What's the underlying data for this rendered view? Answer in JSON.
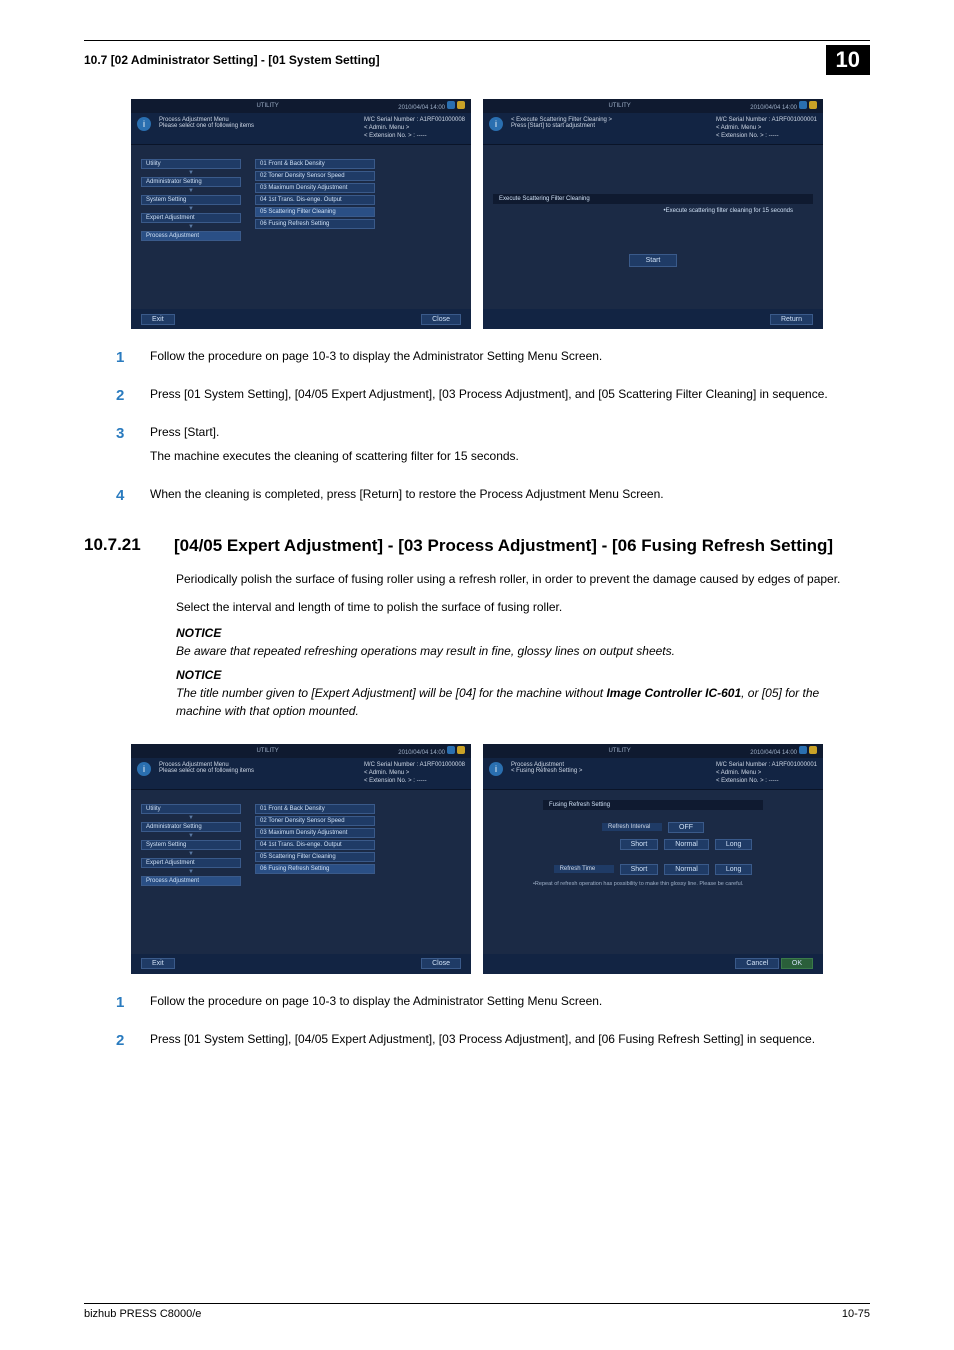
{
  "header": {
    "breadcrumb": "10.7   [02 Administrator Setting] - [01 System Setting]",
    "chapter": "10"
  },
  "screenshots1": {
    "left": {
      "topbar_title": "UTILITY",
      "topbar_date": "2010/04/04 14:00",
      "h_line1": "Process Adjustment Menu",
      "h_line2": "Please select one of following items",
      "r_line1": "M/C Serial Number : A1RF001000008",
      "r_line2": "< Admin. Menu >",
      "r_line3": "< Extension No. > : -----",
      "bread": [
        "Utility",
        "Administrator Setting",
        "System Setting",
        "Expert Adjustment",
        "Process Adjustment"
      ],
      "menu": [
        "01 Front & Back Density",
        "02 Toner Density Sensor Speed",
        "03 Maximum Density Adjustment",
        "04 1st Trans. Dis-enge. Output",
        "05 Scattering Filter Cleaning",
        "06 Fusing Refresh Setting"
      ],
      "menu_hl_index": 4,
      "btn_exit": "Exit",
      "btn_close": "Close"
    },
    "right": {
      "topbar_title": "UTILITY",
      "topbar_date": "2010/04/04 14:00",
      "h_line1": "< Execute Scattering Filter Cleaning >",
      "h_line2": "Press [Start] to start adjustment",
      "r_line1": "M/C Serial Number : A1RF001000001",
      "r_line2": "< Admin. Menu >",
      "r_line3": "< Extension No. > : -----",
      "panel_title": "Execute Scattering Filter Cleaning",
      "note": "•Execute scattering filter cleaning for 15 seconds",
      "btn_start": "Start",
      "btn_return": "Return"
    }
  },
  "steps1": [
    {
      "num": "1",
      "lines": [
        "Follow the procedure on page 10-3 to display the Administrator Setting Menu Screen."
      ]
    },
    {
      "num": "2",
      "lines": [
        "Press [01 System Setting], [04/05 Expert Adjustment], [03 Process Adjustment], and [05 Scattering Filter Cleaning] in sequence."
      ]
    },
    {
      "num": "3",
      "lines": [
        "Press [Start].",
        "The machine executes the cleaning of scattering filter for 15 seconds."
      ]
    },
    {
      "num": "4",
      "lines": [
        "When the cleaning is completed, press [Return] to restore the Process Adjustment Menu Screen."
      ]
    }
  ],
  "section": {
    "num": "10.7.21",
    "title": "[04/05 Expert Adjustment] - [03 Process Adjustment] - [06 Fusing Refresh Setting]"
  },
  "para1": "Periodically polish the surface of fusing roller using a refresh roller, in order to prevent the damage caused by edges of paper.",
  "para2": "Select the interval and length of time to polish the surface of fusing roller.",
  "notice_label": "NOTICE",
  "notice1": "Be aware that repeated refreshing operations may result in fine, glossy lines on output sheets.",
  "notice2_pre": "The title number given to [Expert Adjustment] will be [04] for the machine without ",
  "notice2_bold": "Image Controller IC-601",
  "notice2_post": ", or [05] for the machine with that option mounted.",
  "screenshots2": {
    "left": {
      "topbar_title": "UTILITY",
      "topbar_date": "2010/04/04 14:00",
      "h_line1": "Process Adjustment Menu",
      "h_line2": "Please select one of following items",
      "r_line1": "M/C Serial Number : A1RF001000008",
      "r_line2": "< Admin. Menu >",
      "r_line3": "< Extension No. > : -----",
      "bread": [
        "Utility",
        "Administrator Setting",
        "System Setting",
        "Expert Adjustment",
        "Process Adjustment"
      ],
      "menu": [
        "01 Front & Back Density",
        "02 Toner Density Sensor Speed",
        "03 Maximum Density Adjustment",
        "04 1st Trans. Dis-enge. Output",
        "05 Scattering Filter Cleaning",
        "06 Fusing Refresh Setting"
      ],
      "menu_hl_index": 5,
      "btn_exit": "Exit",
      "btn_close": "Close"
    },
    "right": {
      "topbar_title": "UTILITY",
      "topbar_date": "2010/04/04 14:00",
      "h_line1": "Process Adjustment",
      "h_line2": "< Fusing Refresh Setting >",
      "r_line1": "M/C Serial Number : A1RF001000001",
      "r_line2": "< Admin. Menu >",
      "r_line3": "< Extension No. > : -----",
      "panel_title": "Fusing Refresh Setting",
      "row1_label": "Refresh Interval",
      "row1_opts": [
        "OFF",
        "Short",
        "Normal",
        "Long"
      ],
      "row2_label": "Refresh Time",
      "row2_opts": [
        "Short",
        "Normal",
        "Long"
      ],
      "small_note": "•Repeat of refresh operation has possibility to make thin glossy line. Please be careful.",
      "btn_cancel": "Cancel",
      "btn_ok": "OK"
    }
  },
  "steps2": [
    {
      "num": "1",
      "lines": [
        "Follow the procedure on page 10-3 to display the Administrator Setting Menu Screen."
      ]
    },
    {
      "num": "2",
      "lines": [
        "Press [01 System Setting], [04/05 Expert Adjustment], [03 Process Adjustment], and [06 Fusing Refresh Setting] in sequence."
      ]
    }
  ],
  "footer": {
    "left": "bizhub PRESS C8000/e",
    "right": "10-75"
  }
}
